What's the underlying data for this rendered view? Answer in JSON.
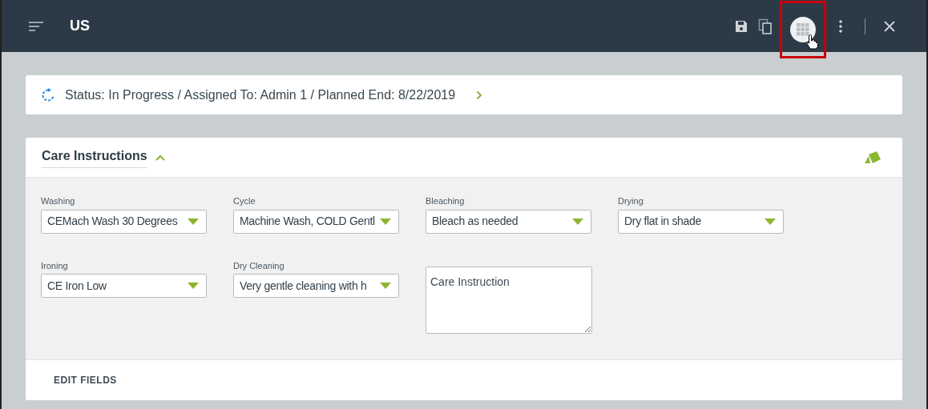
{
  "header": {
    "title": "US",
    "actions": [
      {
        "kind": "save",
        "highlighted": false
      },
      {
        "kind": "copy",
        "highlighted": false
      },
      {
        "kind": "grid",
        "highlighted": true
      },
      {
        "kind": "more",
        "highlighted": false
      },
      {
        "kind": "close",
        "highlighted": false
      }
    ]
  },
  "status": {
    "text": "Status: In Progress / Assigned To: Admin 1 / Planned End: 8/22/2019"
  },
  "section": {
    "title": "Care Instructions",
    "expanded": true,
    "fields": [
      {
        "kind": "select",
        "label": "Washing",
        "value": "CEMach Wash 30 Degrees"
      },
      {
        "kind": "select",
        "label": "Cycle",
        "value": "Machine Wash, COLD Gentl"
      },
      {
        "kind": "select",
        "label": "Bleaching",
        "value": "Bleach as needed"
      },
      {
        "kind": "select",
        "label": "Drying",
        "value": "Dry flat in shade"
      },
      {
        "kind": "select",
        "label": "Ironing",
        "value": "CE Iron Low"
      },
      {
        "kind": "select",
        "label": "Dry Cleaning",
        "value": "Very gentle cleaning with h"
      },
      {
        "kind": "textarea",
        "placeholder": "Care Instruction"
      }
    ],
    "footer_button": "EDIT FIELDS"
  }
}
